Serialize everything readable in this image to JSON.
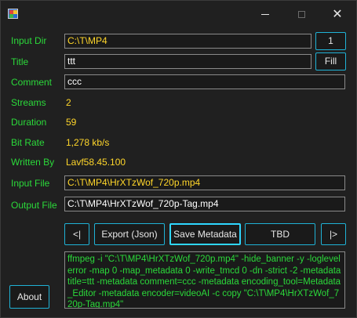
{
  "window": {
    "min_glyph": "",
    "max_glyph": "",
    "close_glyph": "✕"
  },
  "labels": {
    "input_dir": "Input Dir",
    "title": "Title",
    "comment": "Comment",
    "streams": "Streams",
    "duration": "Duration",
    "bit_rate": "Bit Rate",
    "written_by": "Written By",
    "input_file": "Input File",
    "output_file": "Output File"
  },
  "fields": {
    "input_dir": "C:\\T\\MP4",
    "title": "ttt",
    "comment": "ccc",
    "input_file": "C:\\T\\MP4\\HrXTzWof_720p.mp4",
    "output_file": "C:\\T\\MP4\\HrXTzWof_720p-Tag.mp4"
  },
  "values": {
    "streams": "2",
    "duration": "59",
    "bit_rate": "1,278 kb/s",
    "written_by": "Lavf58.45.100"
  },
  "buttons": {
    "count": "1",
    "fill": "Fill",
    "prev": "<|",
    "export_json": "Export (Json)",
    "save_metadata": "Save Metadata",
    "tbd": "TBD",
    "next": "|>",
    "about": "About"
  },
  "command": "ffmpeg -i \"C:\\T\\MP4\\HrXTzWof_720p.mp4\" -hide_banner -y -loglevel error -map 0 -map_metadata 0 -write_tmcd 0 -dn -strict -2 -metadata title=ttt -metadata comment=ccc -metadata encoding_tool=Metadata_Editor -metadata encoder=videoAI -c copy \"C:\\T\\MP4\\HrXTzWof_720p-Tag.mp4\"",
  "colors": {
    "label": "#2bd93a",
    "value": "#ffd62a",
    "button_border": "#1fb2d6",
    "background": "#202020"
  },
  "icons": {
    "app": "app-icon",
    "minimize": "minimize-icon",
    "maximize": "maximize-icon",
    "close": "close-icon"
  }
}
